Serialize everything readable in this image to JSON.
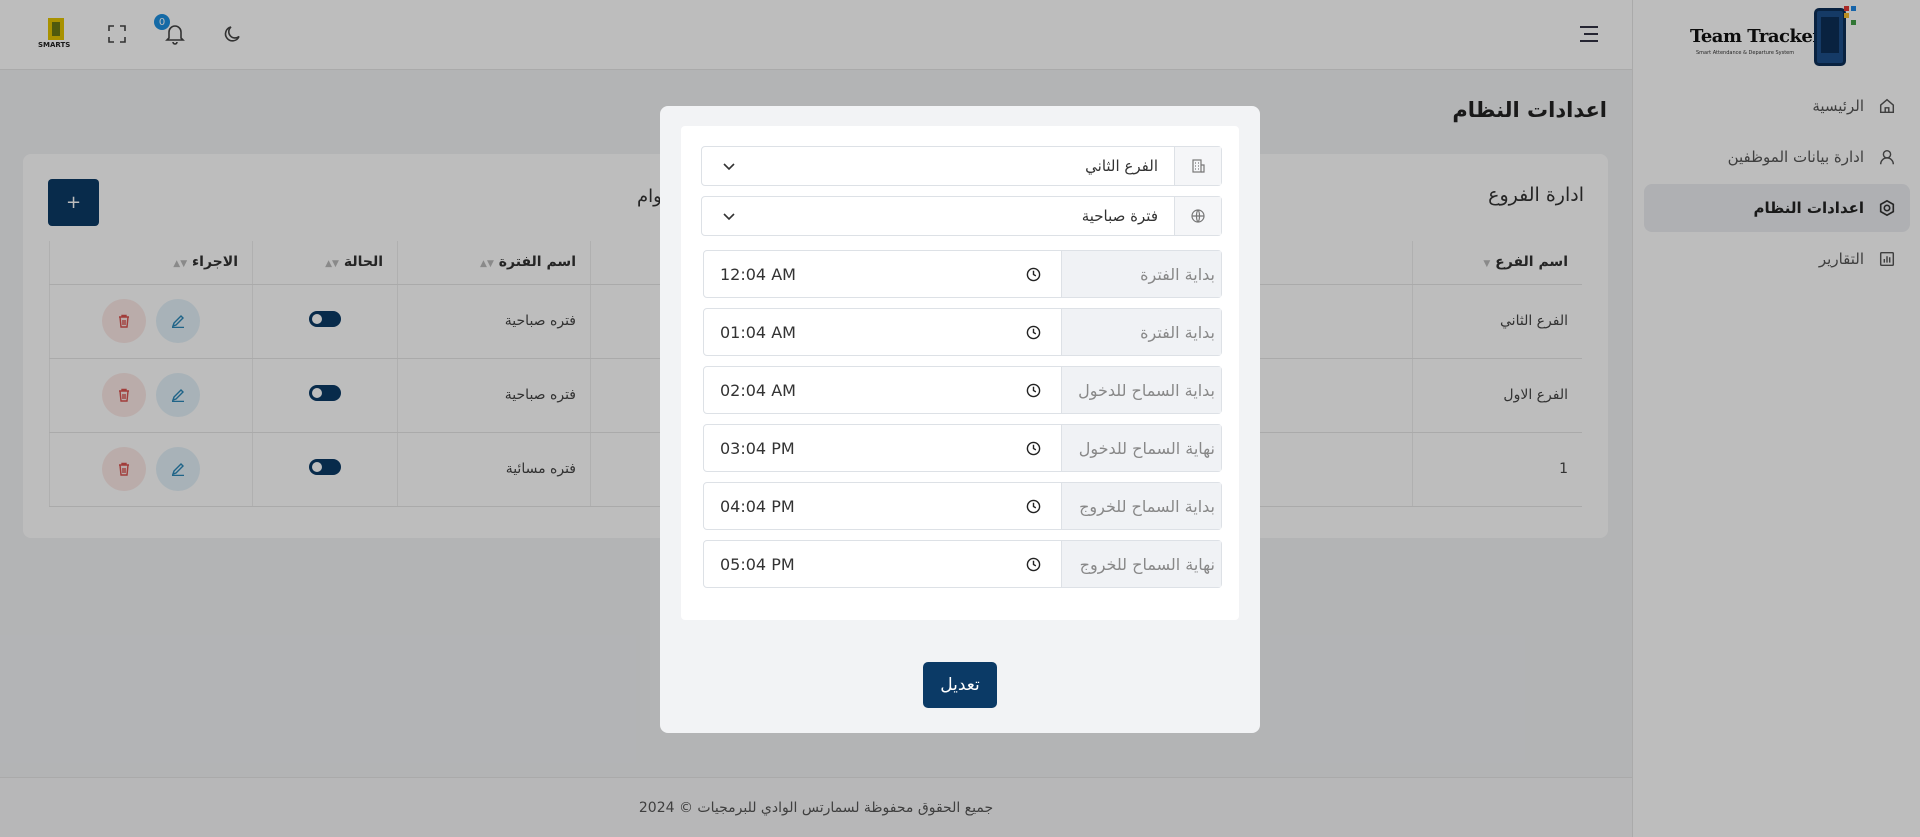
{
  "app": {
    "logo_text": "Team Tracker",
    "logo_subtitle": "Smart Attendance & Departure System",
    "mini_logo_text": "SMARTS"
  },
  "header": {
    "notification_count": "0"
  },
  "sidebar": {
    "items": [
      {
        "label": "الرئيسية",
        "icon": "home-icon"
      },
      {
        "label": "ادارة بيانات الموظفين",
        "icon": "user-icon"
      },
      {
        "label": "اعدادات النظام",
        "icon": "settings-icon",
        "active": true
      },
      {
        "label": "التقارير",
        "icon": "chart-icon"
      }
    ]
  },
  "page": {
    "title": "اعدادات النظام",
    "card_title": "ادارة الفروع",
    "card_title_partial": "وام",
    "add_label": "+"
  },
  "table": {
    "headers": {
      "branch": "اسم الفرع",
      "period": "اسم الفترة",
      "status": "الحالة",
      "actions": "الاجراء"
    },
    "rows": [
      {
        "branch": "الفرع الثاني",
        "period": "فتره صباحية",
        "active": true
      },
      {
        "branch": "الفرع الاول",
        "period": "فتره صباحية",
        "active": true
      },
      {
        "branch": "1",
        "period": "فتره مسائية",
        "active": true
      }
    ]
  },
  "footer": {
    "text": "جميع الحقوق محفوظة لسمارتس الوادي للبرمجيات © 2024"
  },
  "modal": {
    "branch_select": {
      "value": "الفرع الثاني",
      "icon": "building-icon"
    },
    "period_select": {
      "value": "فترة صباحية",
      "icon": "globe-icon"
    },
    "fields": [
      {
        "label": "بداية الفترة",
        "value": "12:04 AM"
      },
      {
        "label": "بداية الفترة",
        "value": "01:04 AM"
      },
      {
        "label": "بداية السماح للدخول",
        "value": "02:04 AM"
      },
      {
        "label": "نهاية السماح للدخول",
        "value": "03:04 PM"
      },
      {
        "label": "بداية السماح للخروج",
        "value": "04:04 PM"
      },
      {
        "label": "نهاية السماح للخروج",
        "value": "05:04 PM"
      }
    ],
    "submit_label": "تعديل"
  },
  "colors": {
    "primary": "#0b3a66",
    "badge": "#1d8fe0",
    "edit_bg": "#e3f1f8",
    "delete_bg": "#fbe8e6"
  }
}
